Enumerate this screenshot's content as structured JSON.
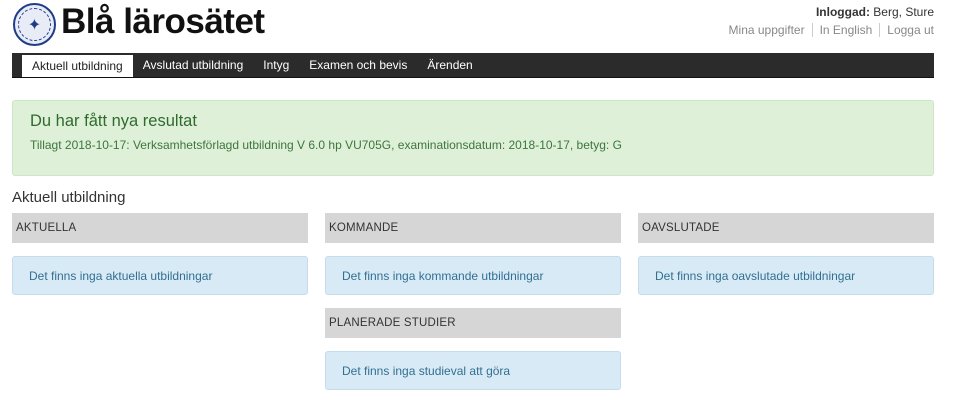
{
  "header": {
    "logo_icon": "university-seal-icon",
    "site_title": "Blå lärosätet",
    "login_label": "Inloggad:",
    "login_user": "Berg, Sture",
    "links": [
      "Mina uppgifter",
      "In English",
      "Logga ut"
    ]
  },
  "nav": {
    "items": [
      "Aktuell utbildning",
      "Avslutad utbildning",
      "Intyg",
      "Examen och bevis",
      "Ärenden"
    ],
    "active_index": 0
  },
  "alert": {
    "title": "Du har fått nya resultat",
    "text": "Tillagt 2018-10-17: Verksamhetsförlagd utbildning V 6.0 hp VU705G, examinationsdatum: 2018-10-17, betyg: G"
  },
  "main": {
    "section_title": "Aktuell utbildning",
    "columns": [
      {
        "heading": "AKTUELLA",
        "message": "Det finns inga aktuella utbildningar"
      },
      {
        "heading": "KOMMANDE",
        "message": "Det finns inga kommande utbildningar"
      },
      {
        "heading": "OAVSLUTADE",
        "message": "Det finns inga oavslutade utbildningar"
      }
    ],
    "planned": {
      "heading": "PLANERADE STUDIER",
      "message": "Det finns inga studieval att göra"
    }
  },
  "colors": {
    "nav_bg": "#2b2b2b",
    "alert_bg": "#dff0d8",
    "alert_text": "#3c763d",
    "info_bg": "#d9eaf7",
    "info_text": "#31708f",
    "heading_bg": "#d6d6d6"
  }
}
